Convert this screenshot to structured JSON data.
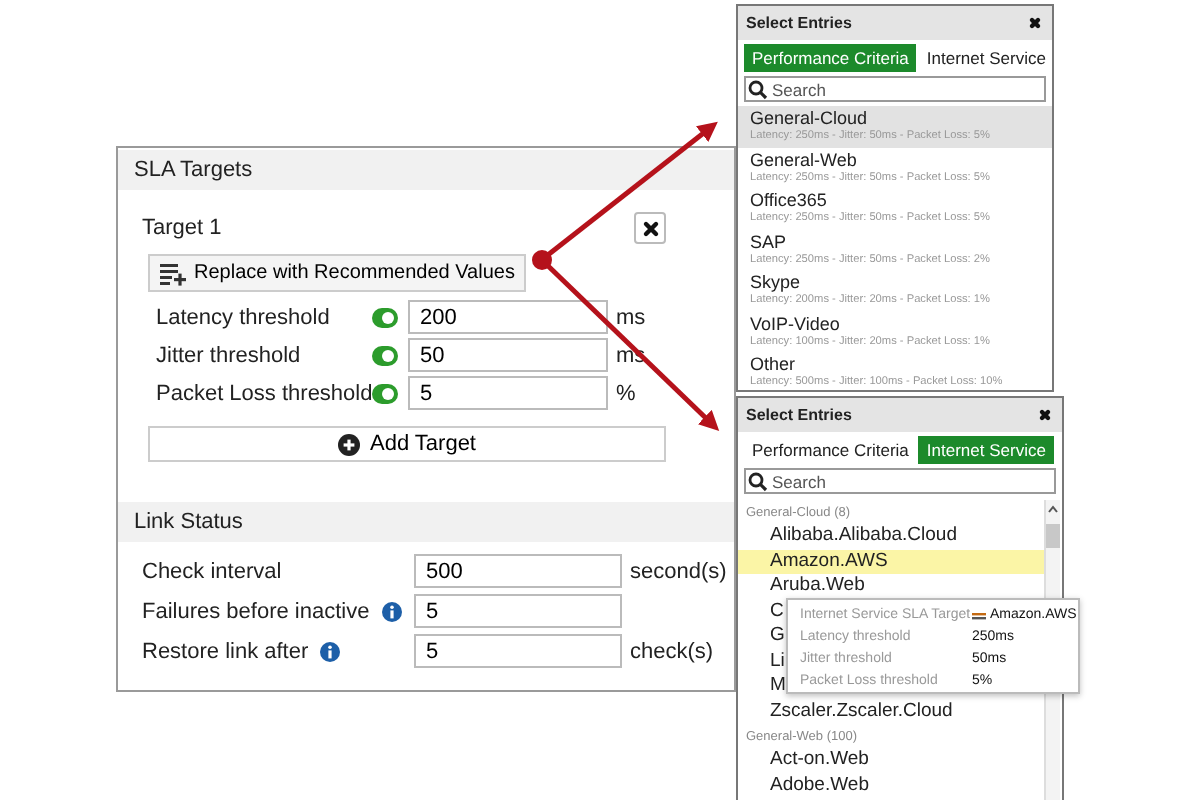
{
  "sla_targets": {
    "title": "SLA Targets",
    "target_title": "Target 1",
    "replace_button": "Replace with Recommended Values",
    "thresholds": [
      {
        "label": "Latency threshold",
        "on": true,
        "value": "200",
        "unit": "ms"
      },
      {
        "label": "Jitter threshold",
        "on": true,
        "value": "50",
        "unit": "ms"
      },
      {
        "label": "Packet Loss threshold",
        "on": true,
        "value": "5",
        "unit": "%"
      }
    ],
    "add_button": "Add Target"
  },
  "link_status": {
    "title": "Link Status",
    "fields": [
      {
        "label": "Check interval",
        "info": false,
        "value": "500",
        "unit": "second(s)"
      },
      {
        "label": "Failures before inactive",
        "info": true,
        "value": "5"
      },
      {
        "label": "Restore link after",
        "info": true,
        "value": "5",
        "unit": "check(s)"
      }
    ]
  },
  "performance_popup": {
    "title": "Select Entries",
    "tabs": [
      {
        "label": "Performance Criteria",
        "selected": true
      },
      {
        "label": "Internet Service",
        "selected": false
      }
    ],
    "search": {
      "placeholder": "Search"
    },
    "entries": [
      {
        "name": "General-Cloud",
        "detail": "Latency: 250ms - Jitter: 50ms - Packet Loss: 5%",
        "selected": true
      },
      {
        "name": "General-Web",
        "detail": "Latency: 250ms - Jitter: 50ms - Packet Loss: 5%",
        "selected": false
      },
      {
        "name": "Office365",
        "detail": "Latency: 250ms - Jitter: 50ms - Packet Loss: 5%",
        "selected": false
      },
      {
        "name": "SAP",
        "detail": "Latency: 250ms - Jitter: 50ms - Packet Loss: 2%",
        "selected": false
      },
      {
        "name": "Skype",
        "detail": "Latency: 200ms - Jitter: 20ms - Packet Loss: 1%",
        "selected": false
      },
      {
        "name": "VoIP-Video",
        "detail": "Latency: 100ms - Jitter: 20ms - Packet Loss: 1%",
        "selected": false
      },
      {
        "name": "Other",
        "detail": "Latency: 500ms - Jitter: 100ms - Packet Loss: 10%",
        "selected": false
      }
    ]
  },
  "service_popup": {
    "title": "Select Entries",
    "tabs": [
      {
        "label": "Performance Criteria",
        "selected": false
      },
      {
        "label": "Internet Service",
        "selected": true
      }
    ],
    "search": {
      "placeholder": "Search"
    },
    "groups": [
      {
        "name": "General-Cloud (8)",
        "items": [
          {
            "name": "Alibaba.Alibaba.Cloud",
            "selected": false
          },
          {
            "name": "Amazon.AWS",
            "selected": true
          },
          {
            "name": "Aruba.Web",
            "selected": false
          },
          {
            "name": "C",
            "selected": false
          },
          {
            "name": "G",
            "selected": false
          },
          {
            "name": "Li",
            "selected": false
          },
          {
            "name": "M",
            "selected": false
          },
          {
            "name": "Zscaler.Zscaler.Cloud",
            "selected": false
          }
        ]
      },
      {
        "name": "General-Web (100)",
        "items": [
          {
            "name": "Act-on.Web",
            "selected": false
          },
          {
            "name": "Adobe.Web",
            "selected": false
          }
        ]
      }
    ]
  },
  "tooltip": {
    "title": "Internet Service SLA Target",
    "service": "Amazon.AWS",
    "rows": [
      {
        "label": "Latency threshold",
        "value": "250ms"
      },
      {
        "label": "Jitter threshold",
        "value": "50ms"
      },
      {
        "label": "Packet Loss threshold",
        "value": "5%"
      }
    ]
  }
}
